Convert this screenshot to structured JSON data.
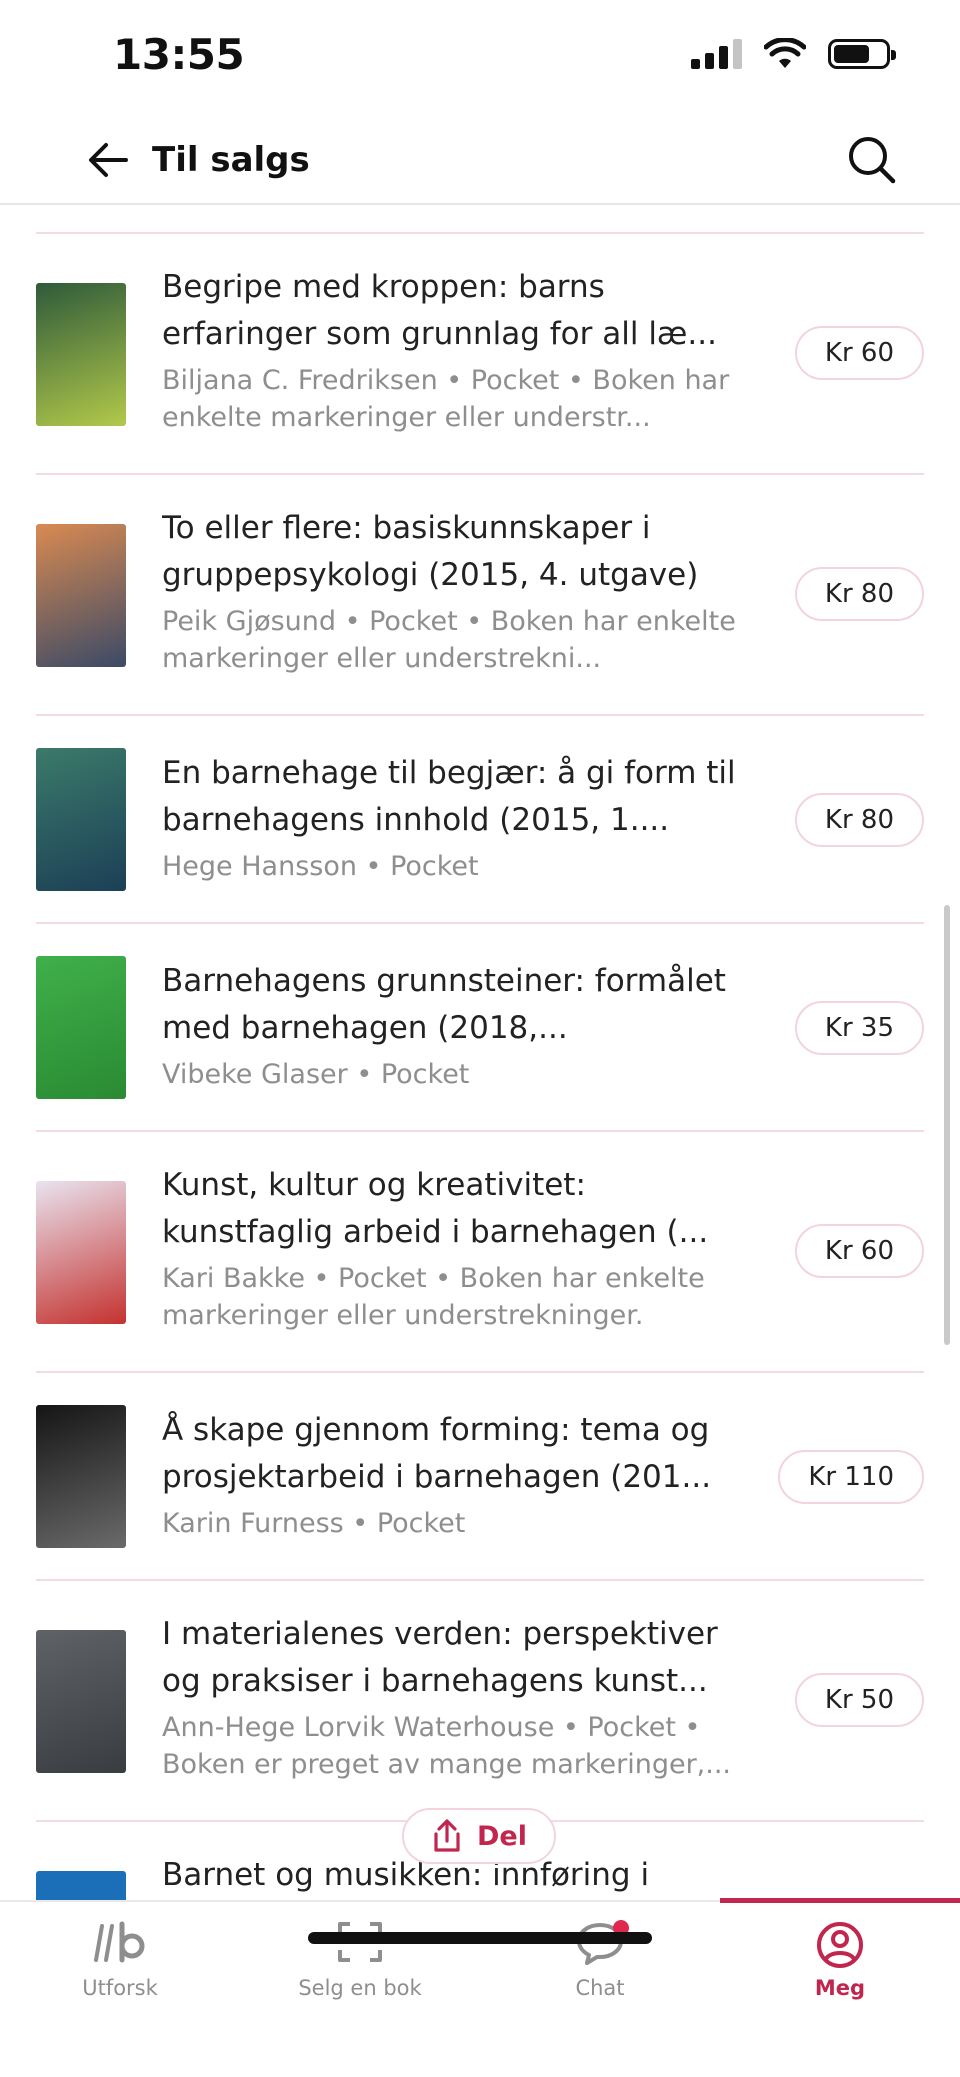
{
  "status_bar": {
    "time": "13:55"
  },
  "header": {
    "title": "Til salgs"
  },
  "listings": [
    {
      "title": "Begripe med kroppen: barns erfaringer som grunnlag for all læ...",
      "meta": "Biljana C. Fredriksen • Pocket • Boken har enkelte markeringer eller understr...",
      "price": "Kr 60",
      "cover_colors": [
        "#2e5a3a",
        "#b2c94a"
      ]
    },
    {
      "title": "To eller flere: basiskunnskaper i gruppepsykologi (2015, 4. utgave)",
      "meta": "Peik Gjøsund • Pocket • Boken har enkelte markeringer eller understrekni...",
      "price": "Kr 80",
      "cover_colors": [
        "#d98a52",
        "#3b4a66"
      ]
    },
    {
      "title": "En barnehage til begjær: å gi form til barnehagens innhold (2015, 1....",
      "meta": "Hege Hansson • Pocket",
      "price": "Kr 80",
      "cover_colors": [
        "#3b7a6a",
        "#1c3f56"
      ]
    },
    {
      "title": "Barnehagens grunnsteiner: formålet med barnehagen (2018,...",
      "meta": "Vibeke Glaser • Pocket",
      "price": "Kr 35",
      "cover_colors": [
        "#3fb04a",
        "#2a8a33"
      ]
    },
    {
      "title": "Kunst, kultur og kreativitet: kunstfaglig arbeid i barnehagen (...",
      "meta": "Kari Bakke • Pocket • Boken har enkelte markeringer eller understrekninger.",
      "price": "Kr 60",
      "cover_colors": [
        "#e9e3ef",
        "#c4322f"
      ]
    },
    {
      "title": "Å skape gjennom forming: tema og prosjektarbeid i barnehagen (201...",
      "meta": "Karin Furness • Pocket",
      "price": "Kr 110",
      "cover_colors": [
        "#151515",
        "#6a6a6a"
      ]
    },
    {
      "title": "I materialenes verden: perspektiver og praksiser i barnehagens kunst...",
      "meta": "Ann-Hege Lorvik Waterhouse • Pocket • Boken er preget av mange markeringer,...",
      "price": "Kr 50",
      "cover_colors": [
        "#5f6266",
        "#393c40"
      ]
    },
    {
      "title": "Barnet og musikken: innføring i",
      "meta": "",
      "price": "",
      "cover_colors": [
        "#1a6fb8",
        "#1a6fb8"
      ]
    }
  ],
  "share": {
    "label": "Del"
  },
  "tabs": [
    {
      "label": "Utforsk",
      "icon": "explore-icon"
    },
    {
      "label": "Selg en bok",
      "icon": "scan-icon"
    },
    {
      "label": "Chat",
      "icon": "chat-icon"
    },
    {
      "label": "Meg",
      "icon": "profile-icon"
    }
  ],
  "colors": {
    "accent": "#c0264e",
    "divider": "#f4dbe0",
    "muted": "#8e8e8e"
  }
}
